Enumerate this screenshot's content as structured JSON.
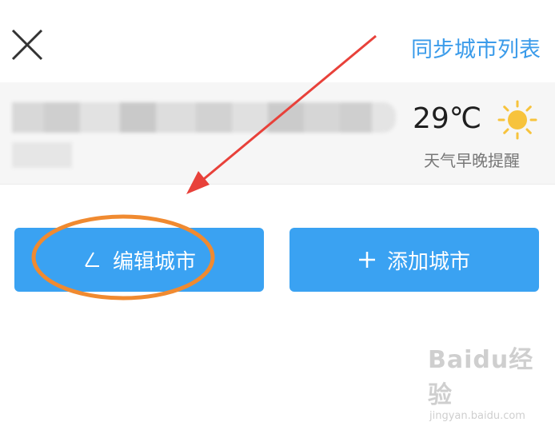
{
  "header": {
    "close_icon": "close-icon",
    "sync_label": "同步城市列表"
  },
  "weather_card": {
    "temperature": "29℃",
    "condition_icon": "sun-icon",
    "reminder_label": "天气早晚提醒"
  },
  "actions": {
    "edit_label": "编辑城市",
    "edit_icon": "edit-icon",
    "add_label": "添加城市",
    "add_icon": "plus-icon"
  },
  "watermark": {
    "line1": "Baidu经验",
    "line2": "jingyan.baidu.com"
  },
  "colors": {
    "accent": "#3aa2f2",
    "link": "#3a9bea",
    "annotation_arrow": "#e8413a",
    "annotation_circle": "#f08a30"
  }
}
